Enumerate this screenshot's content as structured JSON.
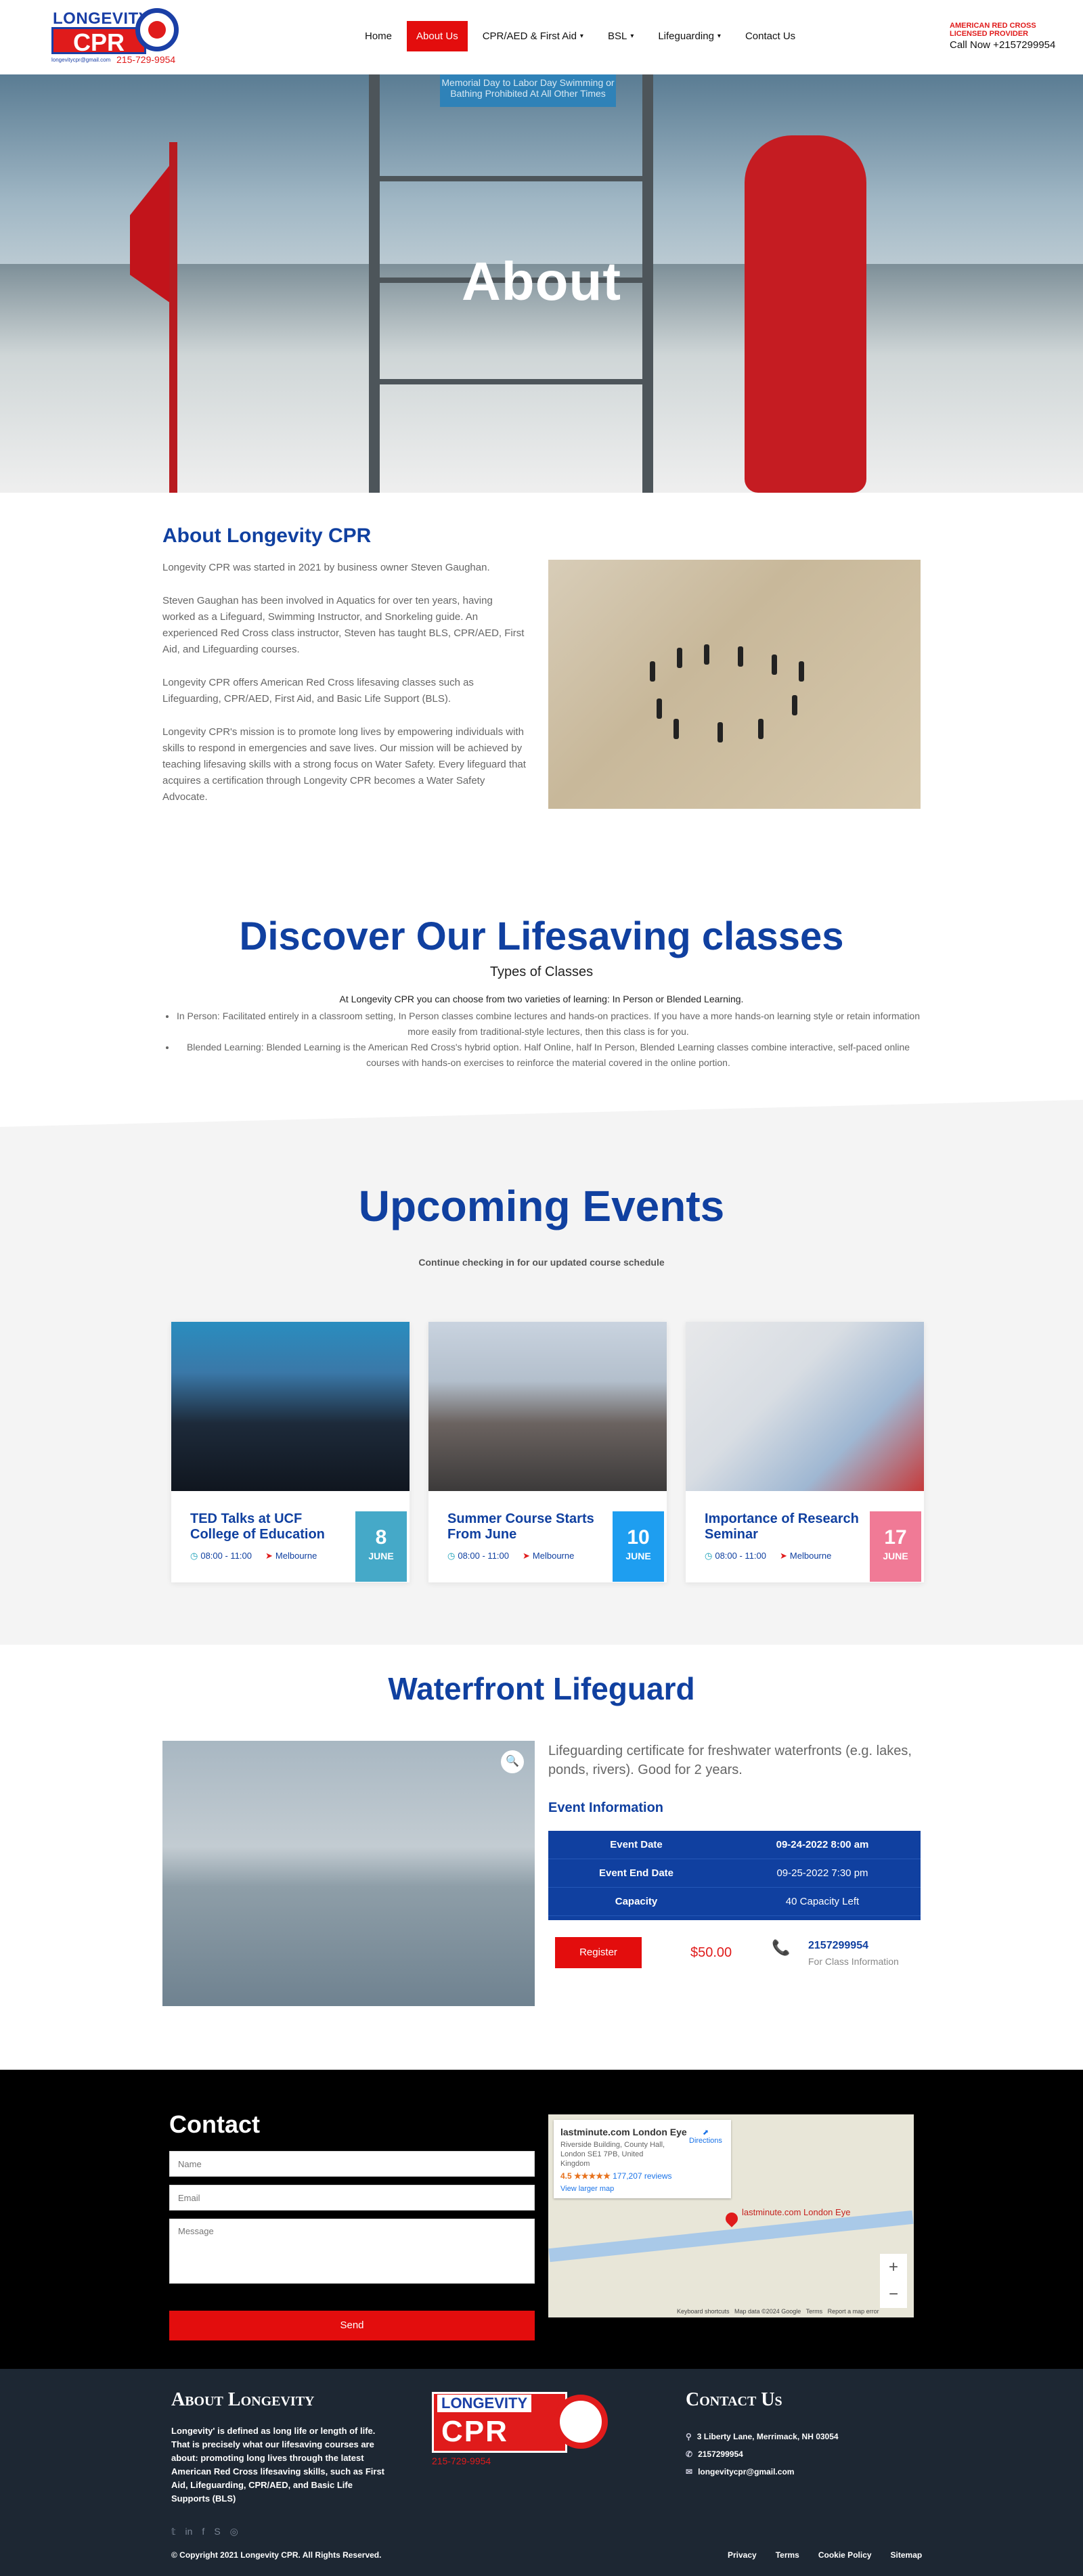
{
  "header": {
    "logo": {
      "brand": "LONGEVITY",
      "cpr": "CPR",
      "email": "longevitycpr@gmail.com",
      "phone": "215-729-9954"
    },
    "nav": [
      {
        "label": "Home"
      },
      {
        "label": "About Us"
      },
      {
        "label": "CPR/AED & First Aid"
      },
      {
        "label": "BSL"
      },
      {
        "label": "Lifeguarding"
      },
      {
        "label": "Contact Us"
      }
    ],
    "badge_line1": "AMERICAN RED CROSS",
    "badge_line2": "LICENSED PROVIDER",
    "call": "Call Now +2157299954"
  },
  "hero": {
    "title": "About",
    "sign_text": "Memorial Day to Labor Day Swimming or Bathing Prohibited At All Other Times"
  },
  "about": {
    "title": "About Longevity CPR",
    "paragraphs": [
      "Longevity CPR was started in 2021 by business owner Steven Gaughan.",
      "Steven Gaughan has been involved in Aquatics for over ten years, having worked as a Lifeguard, Swimming Instructor, and Snorkeling guide. An experienced Red Cross class instructor, Steven has taught BLS, CPR/AED, First Aid, and Lifeguarding courses.",
      "Longevity CPR offers American Red Cross lifesaving classes such as Lifeguarding, CPR/AED, First Aid, and Basic Life Support (BLS).",
      "Longevity CPR's mission is to promote long lives by empowering individuals with skills to respond in emergencies and save lives. Our mission will be achieved by teaching lifesaving skills with a strong focus on Water Safety. Every lifeguard that acquires a certification through Longevity CPR becomes a Water Safety Advocate."
    ]
  },
  "discover": {
    "title": "Discover Our Lifesaving classes",
    "subtitle": "Types of Classes",
    "lead": "At Longevity CPR you can choose from two varieties of learning: In Person or Blended Learning.",
    "items": [
      "In Person: Facilitated entirely in a classroom setting, In Person classes combine lectures and hands-on practices. If you have a more hands-on learning style or retain information more easily from traditional-style lectures, then this class is for you.",
      "Blended Learning: Blended Learning is the American Red Cross's hybrid option. Half Online, half In Person, Blended Learning classes combine interactive, self-paced online courses with hands-on exercises to reinforce the material covered in the online portion."
    ]
  },
  "events": {
    "title": "Upcoming Events",
    "subtitle": "Continue checking in for our updated course schedule",
    "cards": [
      {
        "title": "TED Talks at UCF College of Education",
        "time": "08:00 - 11:00",
        "place": "Melbourne",
        "day": "8",
        "month": "JUNE",
        "color": "#45a9c8"
      },
      {
        "title": "Summer Course Starts From June",
        "time": "08:00 - 11:00",
        "place": "Melbourne",
        "day": "10",
        "month": "JUNE",
        "color": "#1e9ef0"
      },
      {
        "title": "Importance of Research Seminar",
        "time": "08:00 - 11:00",
        "place": "Melbourne",
        "day": "17",
        "month": "JUNE",
        "color": "#f07a96"
      }
    ]
  },
  "waterfront": {
    "title": "Waterfront Lifeguard",
    "description": "Lifeguarding certificate for freshwater waterfronts (e.g. lakes, ponds, rivers). Good for 2 years.",
    "info_title": "Event Information",
    "rows": [
      {
        "key": "Event Date",
        "value": "09-24-2022 8:00 am"
      },
      {
        "key": "Event End Date",
        "value": "09-25-2022 7:30 pm"
      },
      {
        "key": "Capacity",
        "value": "40 Capacity Left"
      }
    ],
    "register": "Register",
    "price": "$50.00",
    "phone": "2157299954",
    "phone_note": "For Class Information"
  },
  "contact": {
    "title": "Contact",
    "name_placeholder": "Name",
    "email_placeholder": "Email",
    "message_placeholder": "Message",
    "send": "Send",
    "map": {
      "place": "lastminute.com London Eye",
      "address": "Riverside Building, County Hall, London SE1 7PB, United Kingdom",
      "rating": "4.5",
      "stars": "★★★★★",
      "reviews": "177,207 reviews",
      "larger": "View larger map",
      "directions": "Directions",
      "pin_label": "lastminute.com London Eye",
      "footer": "Keyboard shortcuts   Map data ©2024 Google   Terms   Report a map error"
    }
  },
  "footer": {
    "about_title": "About Longevity",
    "about_text": "Longevity' is defined as long life or length of life. That is precisely what our lifesaving courses are about: promoting long lives through the latest American Red Cross lifesaving skills, such as First Aid, Lifeguarding, CPR/AED, and Basic Life Supports (BLS)",
    "contact_title": "Contact Us",
    "address": "3 Liberty Lane, Merrimack, NH 03054",
    "phone": "2157299954",
    "email": "longevitycpr@gmail.com",
    "copyright": "© Copyright 2021 Longevity CPR. All Rights Reserved.",
    "links": [
      "Privacy",
      "Terms",
      "Cookie Policy",
      "Sitemap"
    ]
  }
}
